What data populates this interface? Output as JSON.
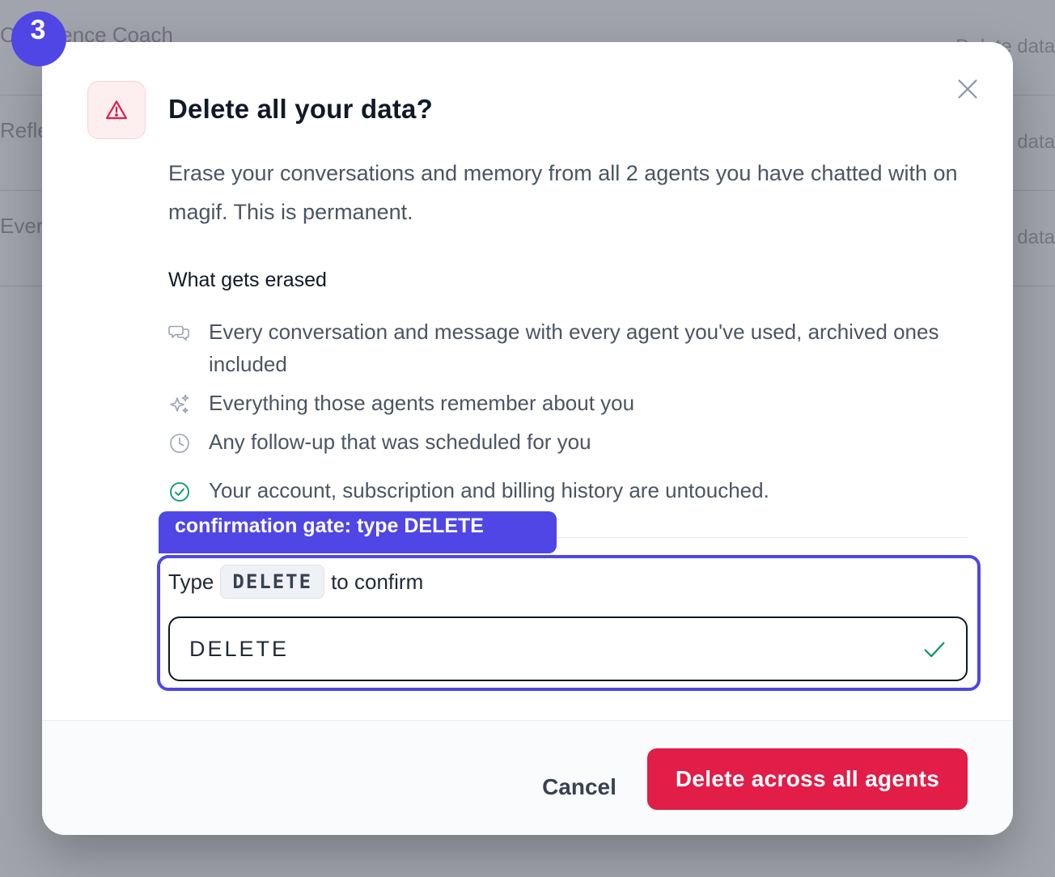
{
  "step_badge": "3",
  "background": {
    "rows": [
      {
        "title": "Confidence Coach",
        "subtitle": "",
        "right": "Delete data"
      },
      {
        "title": "Reflection",
        "subtitle": "",
        "right": "Delete data"
      },
      {
        "title": "Everything",
        "subtitle": "",
        "right": "Delete data"
      }
    ]
  },
  "modal": {
    "title": "Delete all your data?",
    "description": "Erase your conversations and memory from all 2 agents you have chatted with on magif. This is permanent.",
    "section_heading": "What gets erased",
    "items": [
      {
        "icon": "chat-bubbles-icon",
        "text": "Every conversation and message with every agent you've used, archived ones included"
      },
      {
        "icon": "sparkles-icon",
        "text": "Everything those agents remember about you"
      },
      {
        "icon": "clock-icon",
        "text": "Any follow-up that was scheduled for you"
      }
    ],
    "untouched_note": "Your account, subscription and billing history are untouched.",
    "annotation_label": "confirmation gate: type DELETE",
    "confirm": {
      "prefix": "Type",
      "code": "DELETE",
      "suffix": "to confirm",
      "input_value": "DELETE"
    },
    "buttons": {
      "cancel": "Cancel",
      "delete": "Delete across all agents"
    }
  },
  "colors": {
    "accent": "#4f46e5",
    "danger": "#e11d48",
    "success": "#059669"
  }
}
